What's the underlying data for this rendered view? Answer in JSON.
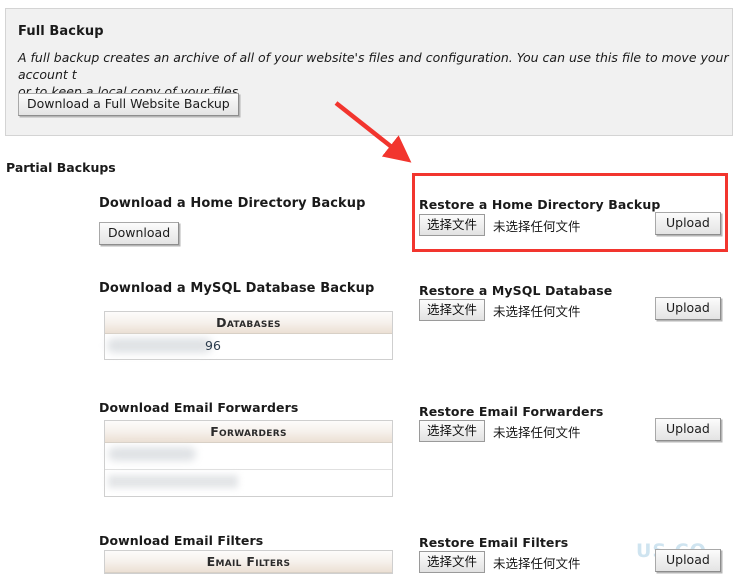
{
  "full_backup": {
    "title": "Full Backup",
    "description": "A full backup creates an archive of all of your website's files and configuration. You can use this file to move your account t\nor to keep a local copy of your files.",
    "download_button": "Download a Full Website Backup"
  },
  "partial_backups": {
    "title": "Partial Backups",
    "sections": [
      {
        "download_heading": "Download a Home Directory Backup",
        "download_button": "Download",
        "restore_heading": "Restore a Home Directory Backup",
        "has_table": false
      },
      {
        "download_heading": "Download a MySQL Database Backup",
        "restore_heading": "Restore a MySQL Database",
        "has_table": true,
        "table_header": "Databases",
        "rows": [
          "96"
        ]
      },
      {
        "download_heading": "Download Email Forwarders",
        "restore_heading": "Restore Email Forwarders",
        "has_table": true,
        "table_header": "Forwarders",
        "rows": [
          "",
          ""
        ]
      },
      {
        "download_heading": "Download Email Filters",
        "restore_heading": "Restore Email Filters",
        "has_table": true,
        "table_header": "Email Filters",
        "rows": []
      }
    ]
  },
  "file_input": {
    "choose_label": "选择文件",
    "no_file_label": "未选择任何文件",
    "upload_label": "Upload"
  },
  "annotations": {
    "arrow_color": "#f2352e",
    "highlight_box_color": "#f2352e",
    "watermark_text": "US CO"
  }
}
